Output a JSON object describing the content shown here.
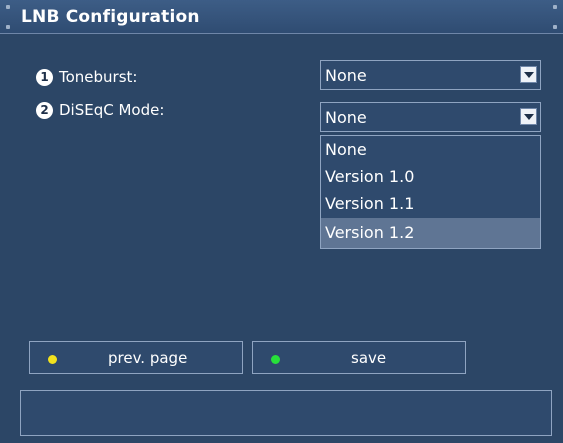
{
  "window": {
    "title": "LNB Configuration"
  },
  "settings": {
    "toneburst": {
      "number": "1",
      "label": "Toneburst:",
      "value": "None"
    },
    "diseqc": {
      "number": "2",
      "label": "DiSEqC Mode:",
      "value": "None",
      "options": [
        "None",
        "Version 1.0",
        "Version 1.1",
        "Version 1.2"
      ],
      "highlighted_option": "Version 1.2"
    }
  },
  "buttons": {
    "prev_page": {
      "label": "prev. page",
      "dot_color": "#f2e21e"
    },
    "save": {
      "label": "save",
      "dot_color": "#27e03a"
    }
  },
  "colors": {
    "background": "#2c4666",
    "border": "#8fa4c1",
    "highlight": "#5f7594",
    "text": "#ffffff"
  },
  "icons": {
    "dropdown": "chevron-down-icon",
    "status_dot": "circle-dot-icon",
    "number_badge": "circled-number-icon"
  },
  "status_bar": {
    "text": ""
  }
}
